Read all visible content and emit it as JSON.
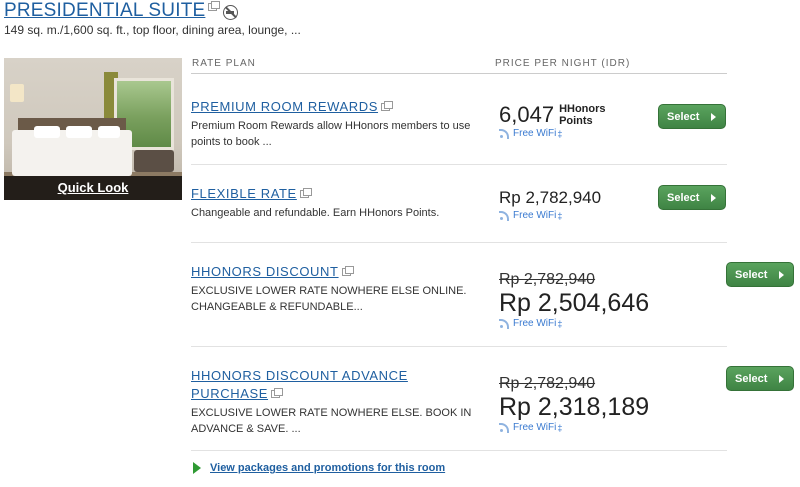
{
  "room": {
    "title": "PRESIDENTIAL SUITE",
    "description": "149 sq. m./1,600 sq. ft., top floor, dining area, lounge, ...",
    "quick_look": "Quick Look"
  },
  "headers": {
    "rate_plan": "RATE PLAN",
    "price": "PRICE PER NIGHT (IDR)"
  },
  "rates": [
    {
      "name": "PREMIUM ROOM REWARDS",
      "description": "Premium Room Rewards allow HHonors members to use points to book ...",
      "points": "6,047",
      "points_unit_1": "HHonors",
      "points_unit_2": "Points",
      "wifi": "Free WiFi",
      "wifi_mark": "‡",
      "select": "Select"
    },
    {
      "name": "FLEXIBLE RATE",
      "description": "Changeable and refundable. Earn HHonors Points.",
      "price": "Rp 2,782,940",
      "wifi": "Free WiFi",
      "wifi_mark": "‡",
      "select": "Select"
    },
    {
      "name": "HHONORS DISCOUNT",
      "description": "EXCLUSIVE LOWER RATE NOWHERE ELSE ONLINE. CHANGEABLE & REFUNDABLE...",
      "original_price": "Rp 2,782,940",
      "price": "Rp 2,504,646",
      "wifi": "Free WiFi",
      "wifi_mark": "‡",
      "select": "Select"
    },
    {
      "name_line_1": "HHONORS DISCOUNT ADVANCE",
      "name_line_2": "PURCHASE",
      "description": "EXCLUSIVE LOWER RATE NOWHERE ELSE. BOOK IN ADVANCE & SAVE. ...",
      "original_price": "Rp 2,782,940",
      "price": "Rp 2,318,189",
      "wifi": "Free WiFi",
      "wifi_mark": "‡",
      "select": "Select"
    }
  ],
  "packages_link": "View packages and promotions for this room"
}
